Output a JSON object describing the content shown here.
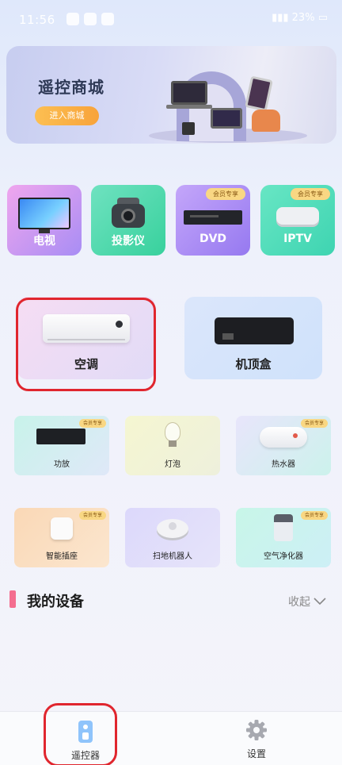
{
  "status_bar": {
    "time": "11:56",
    "battery": "23%"
  },
  "banner": {
    "title": "遥控商城",
    "button_label": "进入商城"
  },
  "top_devices": [
    {
      "label": "电视",
      "color_start": "#f0a6ee",
      "color_end": "#a88df4",
      "vip": ""
    },
    {
      "label": "投影仪",
      "color_start": "#6fe2c0",
      "color_end": "#38d19d",
      "vip": ""
    },
    {
      "label": "DVD",
      "color_start": "#c4a6fa",
      "color_end": "#9679f0",
      "vip": "会员专享"
    },
    {
      "label": "IPTV",
      "color_start": "#68e6c4",
      "color_end": "#3ed4b1",
      "vip": "会员专享"
    }
  ],
  "featured_devices": [
    {
      "label": "空调",
      "color_start": "#f6ddf3",
      "color_end": "#e1dbf7"
    },
    {
      "label": "机顶盒",
      "color_start": "#dbe6fb",
      "color_end": "#cfe2fb"
    }
  ],
  "grid_devices": [
    {
      "label": "功放",
      "color_start": "#c8f3ea",
      "color_end": "#dfe8f8",
      "vip": "会员专享"
    },
    {
      "label": "灯泡",
      "color_start": "#f5f6d1",
      "color_end": "#eef0dc",
      "vip": ""
    },
    {
      "label": "热水器",
      "color_start": "#e8e5fb",
      "color_end": "#ccf2ec",
      "vip": "会员专享"
    },
    {
      "label": "智能插座",
      "color_start": "#fad8b6",
      "color_end": "#fbe6cf",
      "vip": "会员专享"
    },
    {
      "label": "扫地机器人",
      "color_start": "#dcd8fb",
      "color_end": "#e6e4fa",
      "vip": ""
    },
    {
      "label": "空气净化器",
      "color_start": "#c8f6e8",
      "color_end": "#cdeff6",
      "vip": "会员专享"
    }
  ],
  "my_devices": {
    "title": "我的设备",
    "collapse_label": "收起"
  },
  "bottom_nav": [
    {
      "label": "遥控器",
      "icon": "remote-icon"
    },
    {
      "label": "设置",
      "icon": "gear-icon"
    }
  ]
}
